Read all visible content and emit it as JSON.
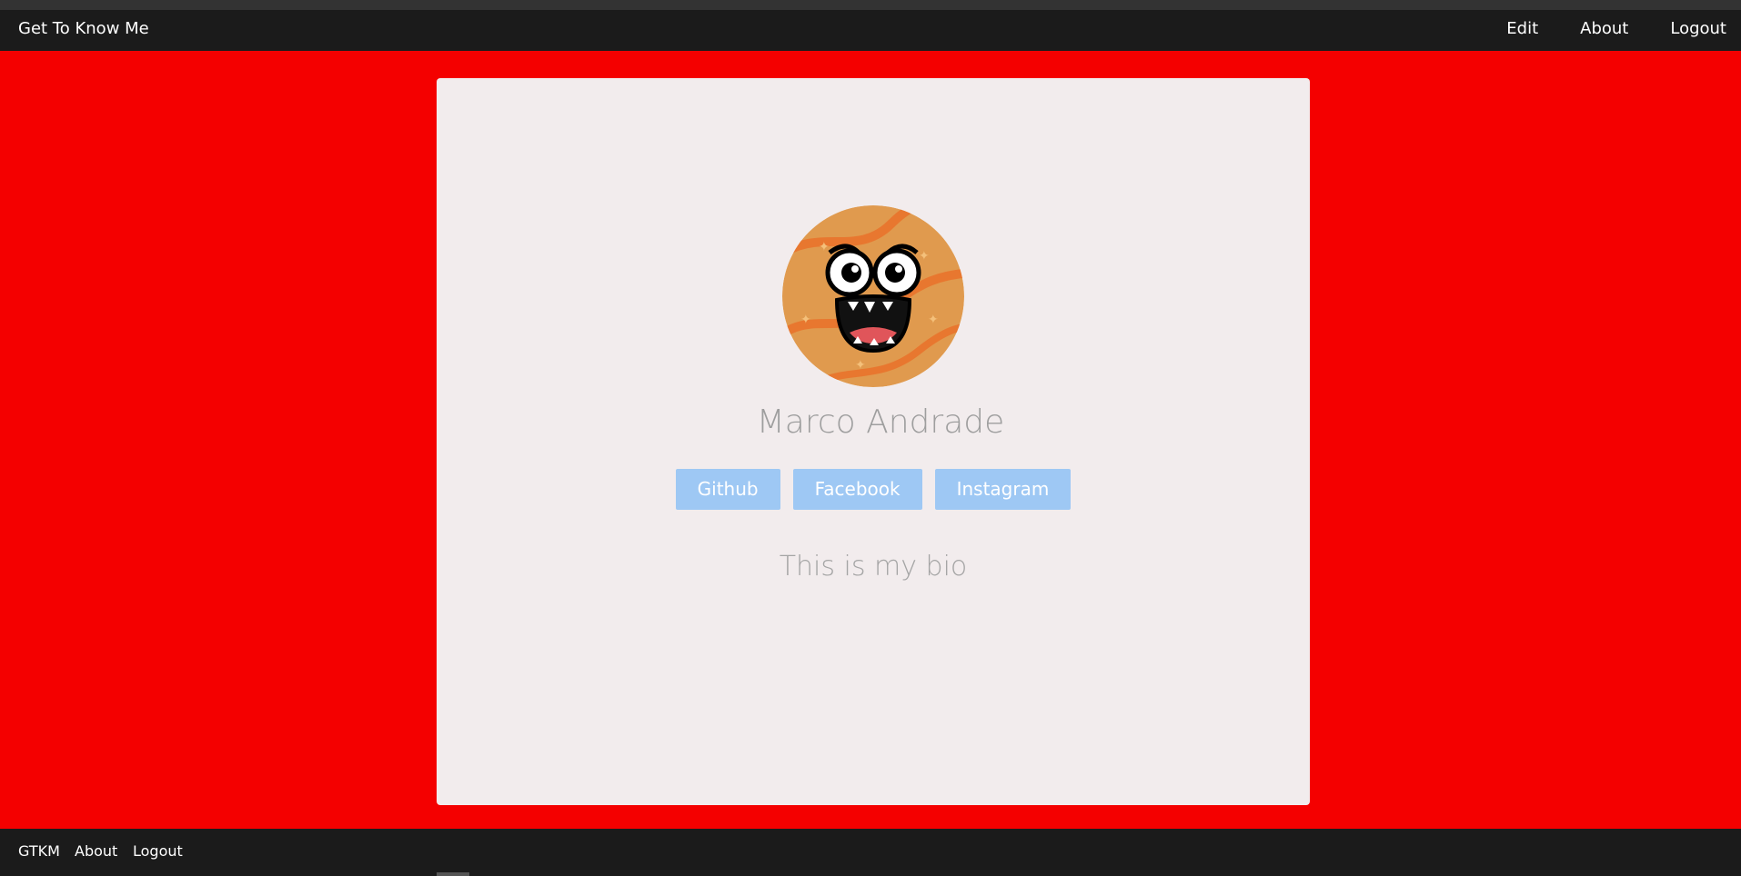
{
  "navbar": {
    "brand": "Get To Know Me",
    "links": [
      "Edit",
      "About",
      "Logout"
    ]
  },
  "profile": {
    "name": "Marco Andrade",
    "links": [
      "Github",
      "Facebook",
      "Instagram"
    ],
    "bio": "This is my bio"
  },
  "footer": {
    "links": [
      "GTKM",
      "About",
      "Logout"
    ]
  },
  "colors": {
    "background": "#f40000",
    "navbar": "#1b1b1b",
    "card": "#f2eced",
    "button": "#9ec8f4"
  }
}
